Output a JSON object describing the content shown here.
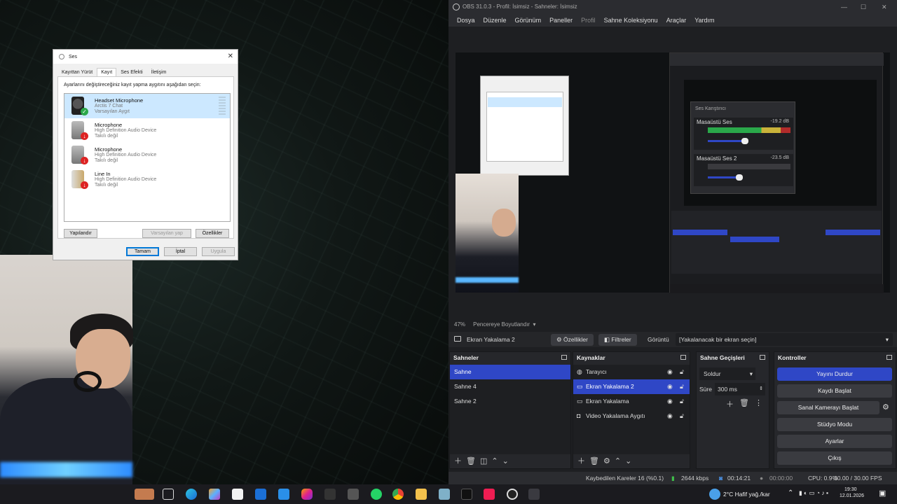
{
  "dialog": {
    "title": "Ses",
    "tabs": [
      "Kayıttan Yürüt",
      "Kayıt",
      "Ses Efekti",
      "İletişim"
    ],
    "active_tab": 1,
    "instruction": "Ayarlarını değiştireceğiniz kayıt yapma aygıtını aşağıdan seçin:",
    "devices": [
      {
        "name": "Headset Microphone",
        "sub1": "Arctis 7 Chat",
        "sub2": "Varsayılan Aygıt",
        "selected": true,
        "status": "ok"
      },
      {
        "name": "Microphone",
        "sub1": "High Definition Audio Device",
        "sub2": "Takılı değil",
        "selected": false,
        "status": "unplugged"
      },
      {
        "name": "Microphone",
        "sub1": "High Definition Audio Device",
        "sub2": "Takılı değil",
        "selected": false,
        "status": "unplugged"
      },
      {
        "name": "Line In",
        "sub1": "High Definition Audio Device",
        "sub2": "Takılı değil",
        "selected": false,
        "status": "unplugged"
      }
    ],
    "configure": "Yapılandır",
    "set_default": "Varsayılan yap",
    "properties": "Özellikler",
    "ok": "Tamam",
    "cancel": "İptal",
    "apply": "Uygula"
  },
  "obs": {
    "title": "OBS 31.0.3 - Profil: İsimsiz - Sahneler: İsimsiz",
    "menu": [
      "Dosya",
      "Düzenle",
      "Görünüm",
      "Paneller",
      "Profil",
      "Sahne Koleksiyonu",
      "Araçlar",
      "Yardım"
    ],
    "zoom": "47%",
    "zoom_mode": "Pencereye Boyutlandır",
    "source_name": "Ekran Yakalama 2",
    "properties_btn": "Özellikler",
    "filters_btn": "Filtreler",
    "display_label": "Görüntü",
    "display_value": "[Yakalanacak bir ekran seçin]",
    "docks": {
      "scenes_title": "Sahneler",
      "scenes": [
        "Sahne",
        "Sahne 4",
        "Sahne 2"
      ],
      "sources_title": "Kaynaklar",
      "sources": [
        "Tarayıcı",
        "Ekran Yakalama 2",
        "Ekran Yakalama",
        "Video Yakalama Aygıtı"
      ],
      "transitions_title": "Sahne Geçişleri",
      "transition": "Soldur",
      "duration_label": "Süre",
      "duration": "300 ms",
      "controls_title": "Kontroller",
      "controls": [
        "Yayını Durdur",
        "Kaydı Başlat",
        "Sanal Kamerayı Başlat",
        "Stüdyo Modu",
        "Ayarlar",
        "Çıkış"
      ]
    },
    "status": {
      "dropped": "Kaybedilen Kareler 16 (%0.1)",
      "bitrate": "2644 kbps",
      "stream_time": "00:14:21",
      "rec_time": "00:00:00",
      "cpu": "CPU: 0.9%",
      "fps": "30.00 / 30.00 FPS"
    },
    "mixer": {
      "title": "Ses Karıştırıcı",
      "track1": "Masaüstü Ses",
      "track1_db": "-19.2 dB",
      "track2": "Masaüstü Ses 2",
      "track2_db": "-23.5 dB"
    }
  },
  "taskbar": {
    "weather": "2°C  Hafif yağ./kar",
    "time": "19:30",
    "date": "12.01.2026"
  },
  "colors": {
    "accent": "#2f47c6",
    "obs_bg": "#1e1f22"
  }
}
